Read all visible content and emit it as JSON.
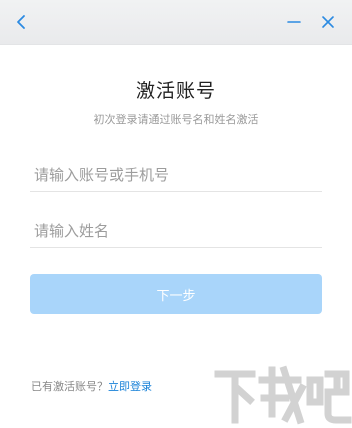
{
  "header": {
    "back_icon": "chevron-left-icon",
    "minimize_icon": "minimize-icon",
    "close_icon": "close-icon",
    "icon_color": "#2b8ae2"
  },
  "main": {
    "title": "激活账号",
    "subtitle": "初次登录请通过账号名和姓名激活",
    "account_field": {
      "placeholder": "请输入账号或手机号",
      "value": ""
    },
    "name_field": {
      "placeholder": "请输入姓名",
      "value": ""
    },
    "next_button_label": "下一步",
    "accent_color": "#a9d5fa"
  },
  "footer": {
    "prompt": "已有激活账号？",
    "login_link": "立即登录"
  },
  "watermark": {
    "logo": "xiazaiba-logo",
    "text": "下载吧"
  }
}
